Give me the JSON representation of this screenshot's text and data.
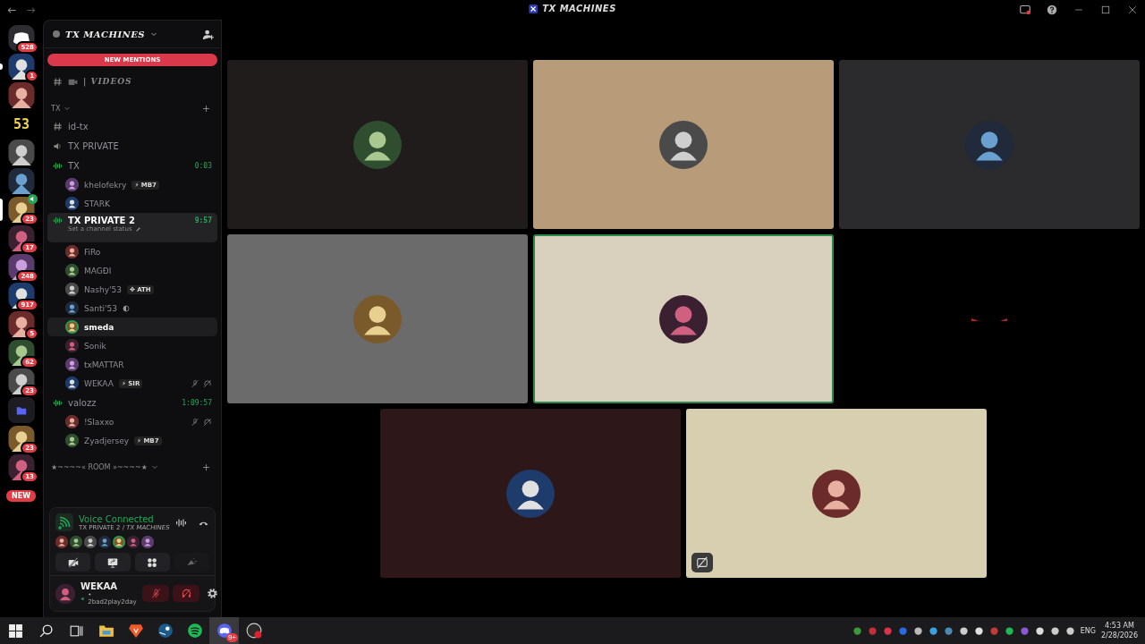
{
  "window": {
    "title": "TX MACHINES"
  },
  "servers": [
    {
      "kind": "home",
      "badge": "528",
      "selected": false,
      "unread": false,
      "voice": false
    },
    {
      "kind": "picture",
      "badge": "1",
      "selected": false,
      "unread": true,
      "voice": false
    },
    {
      "kind": "picture",
      "selected": false,
      "unread": false,
      "voice": false
    },
    {
      "kind": "text",
      "label": "53",
      "selected": false,
      "unread": false,
      "voice": false
    },
    {
      "kind": "picture",
      "selected": false,
      "unread": false,
      "voice": false
    },
    {
      "kind": "picture",
      "selected": false,
      "unread": false,
      "voice": false
    },
    {
      "kind": "picture",
      "badge": "23",
      "selected": true,
      "unread": false,
      "voice": true
    },
    {
      "kind": "picture",
      "badge": "17",
      "selected": false,
      "unread": false,
      "voice": false
    },
    {
      "kind": "picture",
      "badge": "248",
      "selected": false,
      "unread": false,
      "voice": false
    },
    {
      "kind": "picture",
      "badge": "917",
      "selected": false,
      "unread": false,
      "voice": false
    },
    {
      "kind": "picture",
      "badge": "5",
      "selected": false,
      "unread": false,
      "voice": false
    },
    {
      "kind": "picture",
      "badge": "62",
      "selected": false,
      "unread": false,
      "voice": false
    },
    {
      "kind": "picture",
      "badge": "23",
      "selected": false,
      "unread": false,
      "voice": false
    },
    {
      "kind": "folder",
      "selected": false,
      "unread": false,
      "voice": false
    },
    {
      "kind": "picture",
      "badge": "23",
      "selected": false,
      "unread": false,
      "voice": false
    },
    {
      "kind": "picture",
      "badge": "13",
      "selected": false,
      "unread": false,
      "voice": false
    }
  ],
  "new_pill": "NEW",
  "sidebar": {
    "server_name": "TX MACHINES",
    "new_mentions": "NEW MENTIONS",
    "top_channel": {
      "kind": "text",
      "name": "| VIDEOS"
    },
    "categories": [
      {
        "name": "TX",
        "channels": [
          {
            "kind": "text",
            "name": "id-tx",
            "selected": false
          },
          {
            "kind": "voice",
            "name": "TX PRIVATE",
            "selected": false
          },
          {
            "kind": "live",
            "name": "TX",
            "time": "0:03",
            "selected": false,
            "users": [
              {
                "name": "khelofekry",
                "tag_icon": "⚡",
                "tag": "MB7",
                "muted": false,
                "speaking": false,
                "hovered": false
              },
              {
                "name": "STARK",
                "muted": false,
                "speaking": false,
                "hovered": false
              }
            ]
          },
          {
            "kind": "live",
            "name": "TX PRIVATE 2",
            "time": "9:57",
            "status": "Set a channel status",
            "selected": true,
            "users": [
              {
                "name": "FiRo",
                "muted": false,
                "speaking": false,
                "hovered": false
              },
              {
                "name": "MAGĐI",
                "muted": false,
                "speaking": false,
                "hovered": false
              },
              {
                "name": "Nashy'53",
                "tag_icon": "✥",
                "tag": "ATH",
                "muted": false,
                "speaking": false,
                "hovered": false
              },
              {
                "name": "Santi'53",
                "moon": true,
                "muted": false,
                "speaking": false,
                "hovered": false
              },
              {
                "name": "smeda",
                "muted": false,
                "speaking": true,
                "hovered": true
              },
              {
                "name": "Sonik",
                "muted": false,
                "speaking": false,
                "hovered": false
              },
              {
                "name": "txMATTAR",
                "muted": false,
                "speaking": false,
                "hovered": false
              },
              {
                "name": "WEKAA",
                "tag_icon": "⚡",
                "tag": "SIR",
                "muted": true,
                "speaking": false,
                "hovered": false
              }
            ]
          },
          {
            "kind": "live",
            "name": "valozz",
            "time": "1:09:57",
            "selected": false,
            "users": [
              {
                "name": "!Slaxxo",
                "muted": true,
                "speaking": false,
                "hovered": false
              },
              {
                "name": "Zyadjersey",
                "tag_icon": "⚡",
                "tag": "MB7",
                "muted": false,
                "speaking": false,
                "hovered": false
              }
            ]
          }
        ]
      },
      {
        "name": "★~~~~« ROOM »~~~~★"
      }
    ]
  },
  "voice_panel": {
    "status": "Voice Connected",
    "location": "TX PRIVATE 2 / *TX MACHINES*",
    "participants": [
      {
        "speaking": false
      },
      {
        "speaking": false
      },
      {
        "speaking": false
      },
      {
        "speaking": false
      },
      {
        "speaking": true
      },
      {
        "speaking": false
      },
      {
        "speaking": false
      }
    ]
  },
  "user_bar": {
    "name": "WEKAA",
    "custom_status": "• 2bad2play2day",
    "mic_muted": true,
    "deafened": true
  },
  "tiles": [
    {
      "color": "#1f1c1b",
      "speaking": false,
      "overlay_icon": false
    },
    {
      "color": "#b89b78",
      "speaking": false,
      "overlay_icon": false
    },
    {
      "color": "#2b2b2d",
      "speaking": false,
      "overlay_icon": false
    },
    {
      "color": "#6b6b6b",
      "speaking": false,
      "overlay_icon": false
    },
    {
      "color": "#d9d1bd",
      "speaking": true,
      "overlay_icon": false
    },
    {
      "color": "#000000",
      "speaking": false,
      "overlay_icon": false
    },
    {
      "color": "#2e1718",
      "speaking": false,
      "overlay_icon": false
    },
    {
      "color": "#d8ceb0",
      "speaking": false,
      "overlay_icon": true
    }
  ],
  "taskbar": {
    "apps": [
      {
        "kind": "explorer",
        "active": false
      },
      {
        "kind": "brave",
        "active": false
      },
      {
        "kind": "steam",
        "active": false
      },
      {
        "kind": "spotify",
        "active": false
      },
      {
        "kind": "discord",
        "badge": "9+",
        "active": true
      },
      {
        "kind": "obs",
        "active": false
      }
    ],
    "language": "ENG",
    "time": "4:53 AM",
    "date": "2/28/2026"
  }
}
